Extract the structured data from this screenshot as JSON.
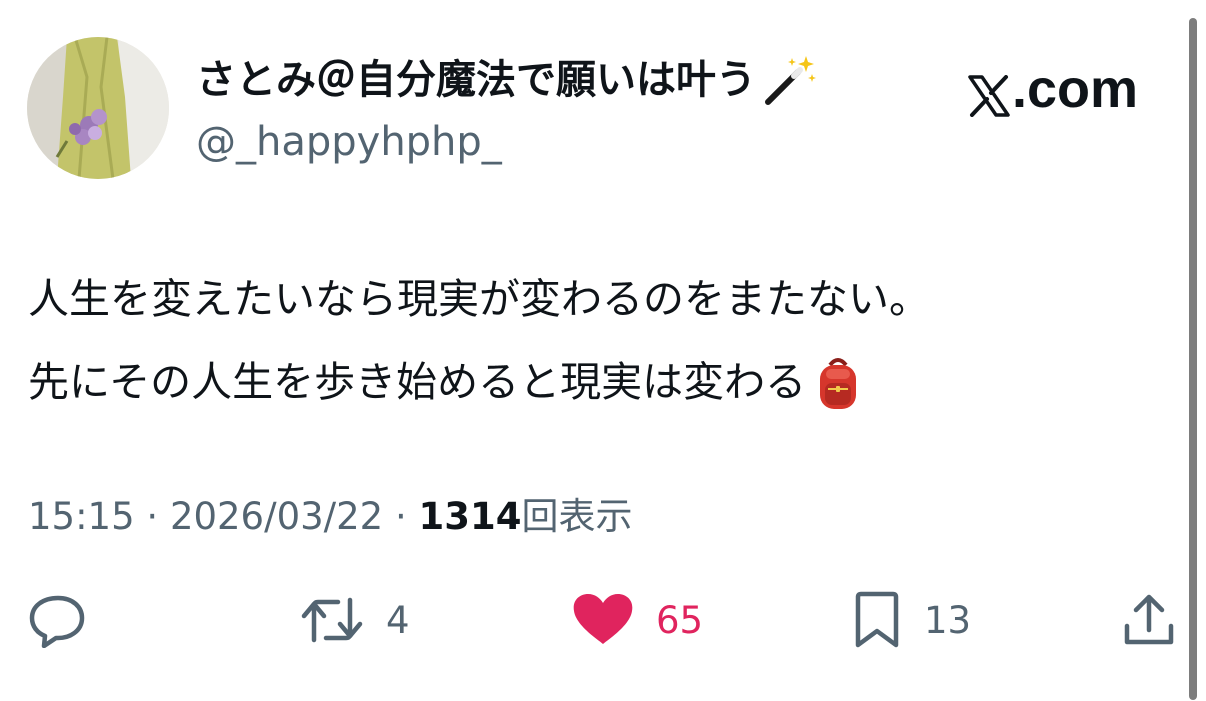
{
  "author": {
    "display_name": "さとみ＠自分魔法で願いは叶う",
    "name_emoji": "magic-wand-icon",
    "handle": "@_happyhphp_"
  },
  "source_badge": {
    "text": ".com",
    "logo": "x-logo-icon"
  },
  "tweet": {
    "line1": "人生を変えたいなら現実が変わるのをまたない。",
    "line2": "先にその人生を歩き始めると現実は変わる",
    "line2_emoji": "backpack-icon"
  },
  "meta": {
    "time": "15:15",
    "separator": "·",
    "date": "2026/03/22",
    "views_count": "1314",
    "views_label": "回表示"
  },
  "actions": {
    "reply": {
      "icon": "reply-icon"
    },
    "retweet": {
      "icon": "retweet-icon",
      "count": "4"
    },
    "like": {
      "icon": "heart-icon",
      "count": "65",
      "liked": true
    },
    "bookmark": {
      "icon": "bookmark-icon",
      "count": "13"
    },
    "share": {
      "icon": "share-icon"
    }
  },
  "colors": {
    "text": "#0f1419",
    "secondary": "#536471",
    "like": "#e0245e"
  }
}
